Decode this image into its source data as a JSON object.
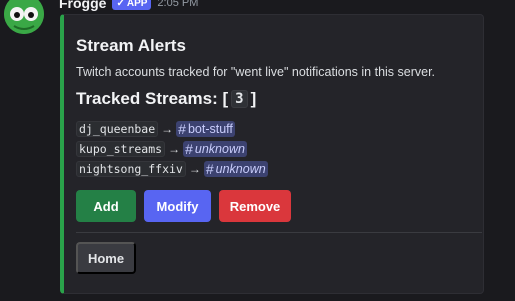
{
  "message": {
    "username": "Frogge",
    "app_badge": "APP",
    "timestamp": "2:05 PM"
  },
  "embed": {
    "accent_color": "#2aa24a",
    "title": "Stream Alerts",
    "description": "Twitch accounts tracked for \"went live\" notifications in this server.",
    "section_prefix": "Tracked Streams: [",
    "section_count": "3",
    "section_suffix": "]",
    "streams": [
      {
        "account": "dj_queenbae",
        "arrow": "→",
        "channel": "bot-stuff",
        "unknown": false
      },
      {
        "account": "kupo_streams",
        "arrow": "→",
        "channel": "unknown",
        "unknown": true
      },
      {
        "account": "nightsong_ffxiv",
        "arrow": "→",
        "channel": "unknown",
        "unknown": true
      }
    ]
  },
  "buttons": {
    "add": "Add",
    "modify": "Modify",
    "remove": "Remove",
    "home": "Home"
  },
  "colors": {
    "add": "#248046",
    "modify": "#5865f2",
    "remove": "#da373c",
    "home": "#3a3b41"
  }
}
